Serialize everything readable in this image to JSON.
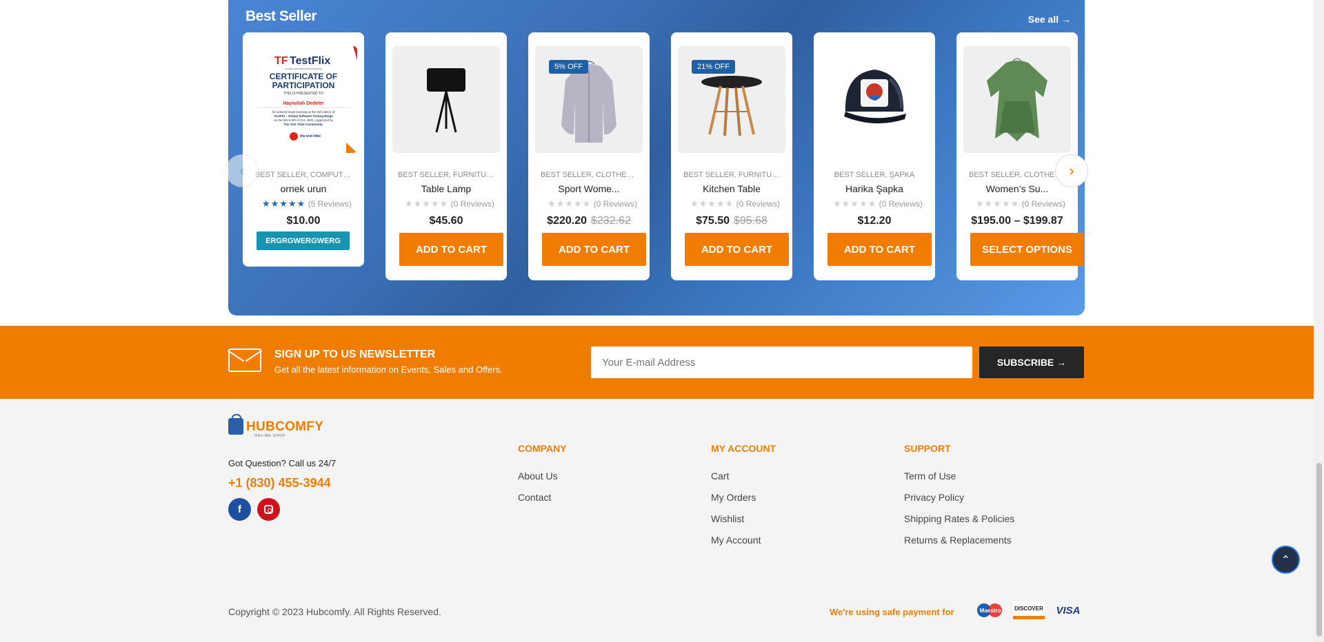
{
  "best_seller": {
    "title": "Best Seller",
    "see_all": "See all →",
    "products": [
      {
        "categories": "BEST SELLER, COMPUTERS",
        "name": "ornek urun",
        "stars": "★★★★★",
        "reviews": "(5 Reviews)",
        "price": "$10.00",
        "old_price": "",
        "badge": "",
        "cta": "ERGRGWERGWERG",
        "image_text": {
          "brand": "TestFlix",
          "brand_sub": "GLOBAL SOFTWARE TESTING BINGE",
          "cert_line1": "CERTIFICATE OF",
          "cert_line2": "PARTICIPATION",
          "presented": "THIS IS PRESENTED TO",
          "person": "Hayrullah Dedeler",
          "body1": "for actively binge learning at the 3rd edition of",
          "body2": "TestFlix - Global Software Testing Binge",
          "body3": "on the 8th & 9th of Oct, 2022, organized by",
          "body4": "The Test Tribe Community.",
          "tribe": "the test tribe"
        }
      },
      {
        "categories": "BEST SELLER, FURNITURE, ...",
        "name": "Table Lamp",
        "stars": "★★★★★",
        "reviews": "(0 Reviews)",
        "price": "$45.60",
        "old_price": "",
        "badge": "",
        "cta": "ADD TO CART"
      },
      {
        "categories": "BEST SELLER, CLOTHES, C...",
        "name": "Sport Wome...",
        "stars": "★★★★★",
        "reviews": "(0 Reviews)",
        "price": "$220.20",
        "old_price": "$232.62",
        "badge": "5% OFF",
        "cta": "ADD TO CART"
      },
      {
        "categories": "BEST SELLER, FURNITURE, ...",
        "name": "Kitchen Table",
        "stars": "★★★★★",
        "reviews": "(0 Reviews)",
        "price": "$75.50",
        "old_price": "$95.68",
        "badge": "21% OFF",
        "cta": "ADD TO CART"
      },
      {
        "categories": "BEST SELLER, ŞAPKA",
        "name": "Harika Şapka",
        "stars": "★★★★★",
        "reviews": "(0 Reviews)",
        "price": "$12.20",
        "old_price": "",
        "badge": "",
        "cta": "ADD TO CART"
      },
      {
        "categories": "BEST SELLER, CLOTHES, C...",
        "name": "Women’s Su...",
        "stars": "★★★★★",
        "reviews": "(0 Reviews)",
        "price": "$195.00 – $199.87",
        "old_price": "",
        "badge": "",
        "cta": "SELECT OPTIONS"
      }
    ],
    "prev_icon": "chevron-left-icon",
    "next_icon": "chevron-right-icon"
  },
  "newsletter": {
    "title": "SIGN UP TO US NEWSLETTER",
    "subtitle": "Get all the latest information on Events, Sales and Offers.",
    "email_placeholder": "Your E-mail Address",
    "subscribe": "SUBSCRIBE →"
  },
  "footer": {
    "logo": "HUBCOMFY",
    "logo_tag": "ONLINE SHOP",
    "question": "Got Question? Call us 24/7",
    "phone": "+1 (830) 455-3944",
    "social": {
      "facebook": "f"
    },
    "company": {
      "heading": "COMPANY",
      "links": [
        "About Us",
        "Contact"
      ]
    },
    "account": {
      "heading": "MY ACCOUNT",
      "links": [
        "Cart",
        "My Orders",
        "Wishlist",
        "My Account"
      ]
    },
    "support": {
      "heading": "SUPPORT",
      "links": [
        "Term of Use",
        "Privacy Policy",
        "Shipping Rates & Policies",
        "Returns & Replacements"
      ]
    },
    "copyright": "Copyright © 2023 Hubcomfy. All Rights Reserved.",
    "safe_payment": "We're using safe payment for",
    "payments": {
      "maestro": "Maestro",
      "discover": "DISCOVER",
      "visa": "VISA"
    }
  },
  "back_to_top": "⌃",
  "colors": {
    "accent": "#f07d00",
    "primary": "#1f5fa3",
    "teal": "#1795b0",
    "dark": "#262626"
  }
}
